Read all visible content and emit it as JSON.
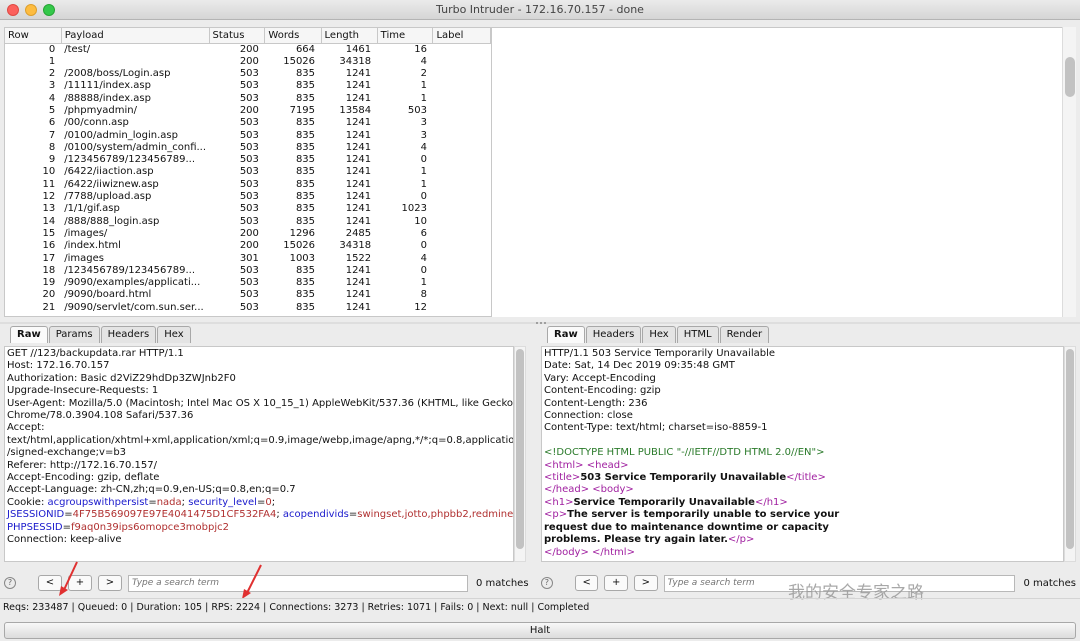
{
  "window": {
    "title": "Turbo Intruder - 172.16.70.157 - done"
  },
  "results_table": {
    "headers": [
      "Row",
      "Payload",
      "Status",
      "Words",
      "Length",
      "Time",
      "Label"
    ],
    "rows": [
      [
        "0",
        "/test/",
        "200",
        "664",
        "1461",
        "16",
        ""
      ],
      [
        "1",
        "",
        "200",
        "15026",
        "34318",
        "4",
        ""
      ],
      [
        "2",
        "/2008/boss/Login.asp",
        "503",
        "835",
        "1241",
        "2",
        ""
      ],
      [
        "3",
        "/11111/index.asp",
        "503",
        "835",
        "1241",
        "1",
        ""
      ],
      [
        "4",
        "/88888/index.asp",
        "503",
        "835",
        "1241",
        "1",
        ""
      ],
      [
        "5",
        "/phpmyadmin/",
        "200",
        "7195",
        "13584",
        "503",
        ""
      ],
      [
        "6",
        "/00/conn.asp",
        "503",
        "835",
        "1241",
        "3",
        ""
      ],
      [
        "7",
        "/0100/admin_login.asp",
        "503",
        "835",
        "1241",
        "3",
        ""
      ],
      [
        "8",
        "/0100/system/admin_confi...",
        "503",
        "835",
        "1241",
        "4",
        ""
      ],
      [
        "9",
        "/123456789/123456789...",
        "503",
        "835",
        "1241",
        "0",
        ""
      ],
      [
        "10",
        "/6422/iiaction.asp",
        "503",
        "835",
        "1241",
        "1",
        ""
      ],
      [
        "11",
        "/6422/iiwiznew.asp",
        "503",
        "835",
        "1241",
        "1",
        ""
      ],
      [
        "12",
        "/7788/upload.asp",
        "503",
        "835",
        "1241",
        "0",
        ""
      ],
      [
        "13",
        "/1/1/gif.asp",
        "503",
        "835",
        "1241",
        "1023",
        ""
      ],
      [
        "14",
        "/888/888_login.asp",
        "503",
        "835",
        "1241",
        "10",
        ""
      ],
      [
        "15",
        "/images/",
        "200",
        "1296",
        "2485",
        "6",
        ""
      ],
      [
        "16",
        "/index.html",
        "200",
        "15026",
        "34318",
        "0",
        ""
      ],
      [
        "17",
        "/images",
        "301",
        "1003",
        "1522",
        "4",
        ""
      ],
      [
        "18",
        "/123456789/123456789...",
        "503",
        "835",
        "1241",
        "0",
        ""
      ],
      [
        "19",
        "/9090/examples/applicati...",
        "503",
        "835",
        "1241",
        "1",
        ""
      ],
      [
        "20",
        "/9090/board.html",
        "503",
        "835",
        "1241",
        "8",
        ""
      ],
      [
        "21",
        "/9090/servlet/com.sun.ser...",
        "503",
        "835",
        "1241",
        "12",
        ""
      ]
    ]
  },
  "request_pane": {
    "tabs": [
      "Raw",
      "Params",
      "Headers",
      "Hex"
    ],
    "active_tab": "Raw",
    "lines": [
      "GET //123/backupdata.rar HTTP/1.1",
      "Host: 172.16.70.157",
      "Authorization: Basic d2ViZ29hdDp3ZWJnb2F0",
      "Upgrade-Insecure-Requests: 1",
      "User-Agent: Mozilla/5.0 (Macintosh; Intel Mac OS X 10_15_1) AppleWebKit/537.36 (KHTML, like Gecko)",
      "Chrome/78.0.3904.108 Safari/537.36",
      "Accept:",
      "text/html,application/xhtml+xml,application/xml;q=0.9,image/webp,image/apng,*/*;q=0.8,application",
      "/signed-exchange;v=b3",
      "Referer: http://172.16.70.157/",
      "Accept-Encoding: gzip, deflate",
      "Accept-Language: zh-CN,zh;q=0.9,en-US;q=0.8,en;q=0.7"
    ],
    "cookie": {
      "prefix": "Cookie: ",
      "k1": "acgroupswithpersist",
      "v1": "nada",
      "k2": "security_level",
      "v2": "0",
      "k3": "JSESSIONID",
      "v3": "4F75B569097E97E4041475D1CF532FA4",
      "k4": "acopendivids",
      "v4": "swingset,jotto,phpbb2,redmine",
      "k5": "PHPSESSID",
      "v5": "f9aq0n39ips6omopce3mobpjc2"
    },
    "last_line": "Connection: keep-alive"
  },
  "response_pane": {
    "tabs": [
      "Raw",
      "Headers",
      "Hex",
      "HTML",
      "Render"
    ],
    "active_tab": "Raw",
    "header_lines": [
      "HTTP/1.1 503 Service Temporarily Unavailable",
      "Date: Sat, 14 Dec 2019 09:35:48 GMT",
      "Vary: Accept-Encoding",
      "Content-Encoding: gzip",
      "Content-Length: 236",
      "Connection: close",
      "Content-Type: text/html; charset=iso-8859-1"
    ],
    "doctype": "<!DOCTYPE HTML PUBLIC \"-//IETF//DTD HTML 2.0//EN\">",
    "title_text": "503 Service Temporarily Unavailable",
    "h1_text": "Service Temporarily Unavailable",
    "p_lines": [
      "The server is temporarily unable to service your",
      "request due to maintenance downtime or capacity",
      "problems. Please try again later."
    ]
  },
  "search_left": {
    "prev": "<",
    "add": "+",
    "next": ">",
    "placeholder": "Type a search term",
    "matches": "0 matches",
    "help": "?"
  },
  "search_right": {
    "prev": "<",
    "add": "+",
    "next": ">",
    "placeholder": "Type a search term",
    "matches": "0 matches",
    "help": "?"
  },
  "status_bar": {
    "text": "Reqs: 233487 | Queued: 0 | Duration: 105 | RPS: 2224 | Connections: 3273 | Retries: 1071 | Fails: 0 | Next: null | Completed"
  },
  "halt_button": {
    "label": "Halt"
  },
  "watermark": {
    "text": "我的安全专家之路"
  },
  "colors": {
    "arrow": "#e03030",
    "cookie_key": "#1a1acc",
    "cookie_value": "#b03030",
    "html_tag": "#a020a0",
    "doctype": "#2a7a2a"
  }
}
